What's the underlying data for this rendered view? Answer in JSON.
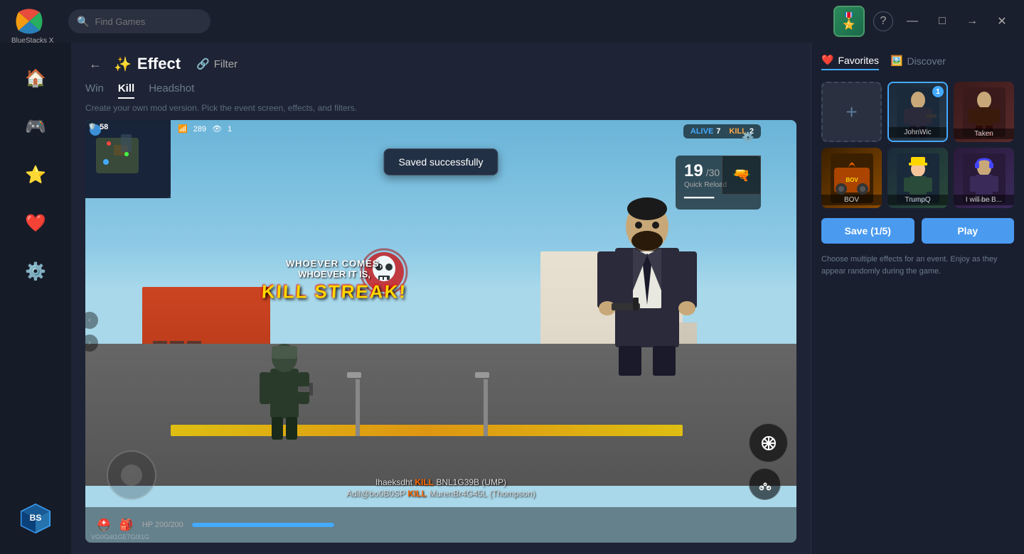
{
  "app": {
    "name": "BlueStacks X",
    "search_placeholder": "Find Games"
  },
  "titlebar": {
    "help_label": "?",
    "minimize_label": "—",
    "maximize_label": "□",
    "forward_label": "→",
    "close_label": "✕"
  },
  "sidebar": {
    "items": [
      {
        "id": "home",
        "icon": "🏠",
        "label": "Home"
      },
      {
        "id": "store",
        "icon": "🎮",
        "label": "Store"
      },
      {
        "id": "effects",
        "icon": "⭐",
        "label": "Effects",
        "active": true
      },
      {
        "id": "favorites",
        "icon": "❤️",
        "label": "Favorites"
      },
      {
        "id": "settings",
        "icon": "⚙️",
        "label": "Settings"
      }
    ],
    "cube_icon": "🎲"
  },
  "header": {
    "back_label": "←",
    "title": "Effect",
    "filter_label": "Filter"
  },
  "tabs": [
    {
      "id": "win",
      "label": "Win",
      "active": false
    },
    {
      "id": "kill",
      "label": "Kill",
      "active": true
    },
    {
      "id": "headshot",
      "label": "Headshot",
      "active": false
    }
  ],
  "subtitle": "Create your own mod version. Pick the event screen, effects, and filters.",
  "toast": {
    "message": "Saved successfully"
  },
  "game": {
    "hud": {
      "minimap_shield": "🛡️",
      "shield_value": "58",
      "wifi": "📶",
      "ping": "289",
      "eye": "👁",
      "alive_label": "ALIVE",
      "alive_value": "7",
      "kill_label": "KILL",
      "kill_value": "2",
      "ammo_current": "19",
      "ammo_total": "30",
      "reload_label": "Quick Reload",
      "kill_streak": "KILL STREAK!",
      "whoever_text": "WHOEVER COMES, WHOEVER IT IS,",
      "hp_text": "HP 200/200",
      "version": "VG0GdI1GE7G0I1G"
    },
    "kill_feed": [
      "Ihaeksdht KILL BNL1G39B (UMP)",
      "Adil@boOB0SP KILL MurenBr4G45L (Thompson)"
    ]
  },
  "right_panel": {
    "tabs": [
      {
        "id": "favorites",
        "label": "Favorites",
        "icon": "❤️",
        "active": true
      },
      {
        "id": "discover",
        "label": "Discover",
        "icon": "🖼️",
        "active": false
      }
    ],
    "effects": [
      {
        "id": "add",
        "type": "add",
        "label": "+"
      },
      {
        "id": "johnwick",
        "label": "JohnWic",
        "badge": "1",
        "selected": true,
        "emoji": "🕴️"
      },
      {
        "id": "taken",
        "label": "Taken",
        "emoji": "🎬"
      },
      {
        "id": "bov",
        "label": "BOV",
        "emoji": "🔥"
      },
      {
        "id": "trumpq",
        "label": "TrumpQ",
        "emoji": "🎩"
      },
      {
        "id": "iwillbe",
        "label": "I will be B...",
        "emoji": "🎭"
      }
    ],
    "save_btn": "Save (1/5)",
    "play_btn": "Play",
    "help_text": "Choose multiple effects for an event. Enjoy as they appear randomly during the game."
  }
}
